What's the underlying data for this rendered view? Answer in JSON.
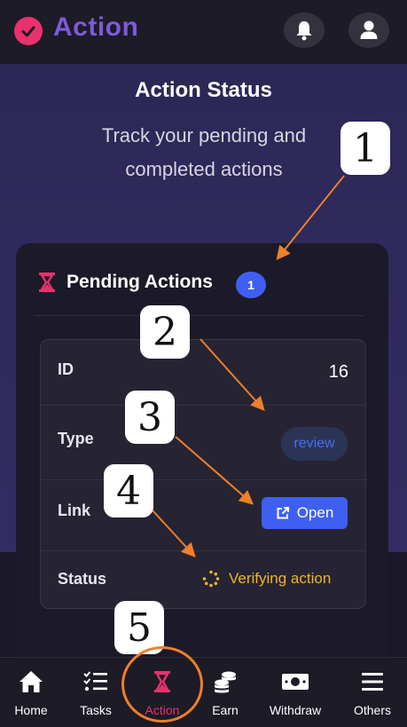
{
  "app": {
    "title": "Action",
    "accent": "#e8316e",
    "brand_color": "#7c5ad9"
  },
  "header": {
    "bell_icon": "bell-icon",
    "user_icon": "user-icon"
  },
  "hero": {
    "title": "Action Status",
    "subtitle_line1": "Track your pending and",
    "subtitle_line2": "completed actions"
  },
  "card": {
    "title": "Pending Actions",
    "count": "1",
    "icon": "hourglass-icon"
  },
  "details": {
    "id_label": "ID",
    "id_value": "16",
    "type_label": "Type",
    "type_value": "review",
    "link_label": "Link",
    "open_label": "Open",
    "status_label": "Status",
    "status_value": "Verifying action",
    "status_color": "#f0b429"
  },
  "callouts": [
    "1",
    "2",
    "3",
    "4",
    "5"
  ],
  "nav": {
    "items": [
      {
        "label": "Home",
        "icon": "home-icon"
      },
      {
        "label": "Tasks",
        "icon": "tasks-icon"
      },
      {
        "label": "Action",
        "icon": "hourglass-icon",
        "active": true
      },
      {
        "label": "Earn",
        "icon": "coins-icon"
      },
      {
        "label": "Withdraw",
        "icon": "money-icon"
      },
      {
        "label": "Others",
        "icon": "menu-icon"
      }
    ]
  }
}
